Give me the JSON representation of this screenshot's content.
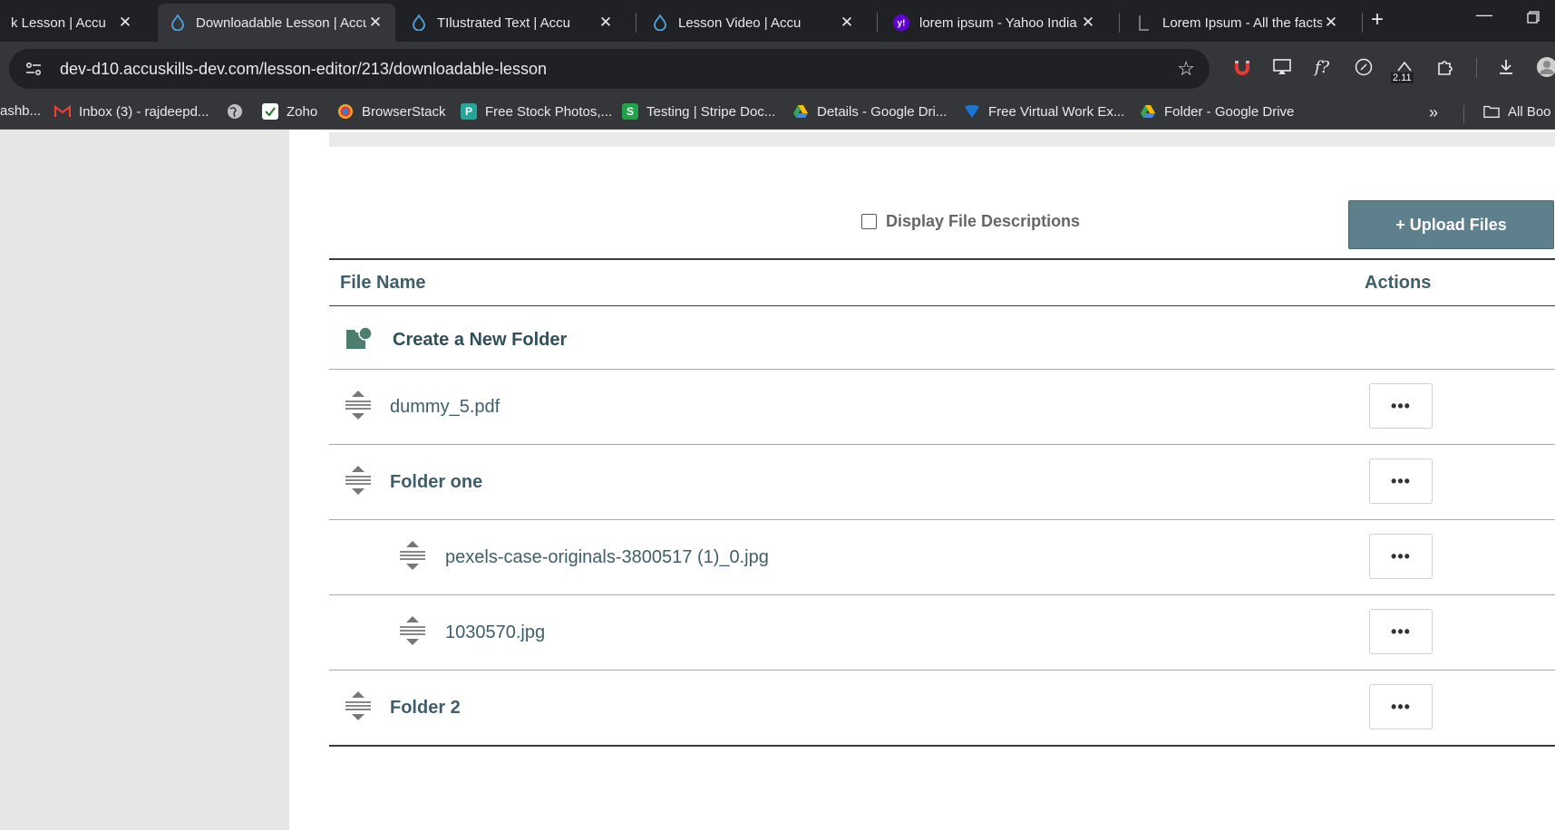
{
  "browser": {
    "tabs": [
      {
        "title": "k Lesson | Accu",
        "active": false
      },
      {
        "title": "Downloadable Lesson | Accu",
        "active": true
      },
      {
        "title": "TIlustrated Text | Accu",
        "active": false
      },
      {
        "title": "Lesson Video | Accu",
        "active": false
      },
      {
        "title": "lorem ipsum - Yahoo India",
        "active": false
      },
      {
        "title": "Lorem Ipsum - All the facts",
        "active": false
      }
    ],
    "url": "dev-d10.accuskills-dev.com/lesson-editor/213/downloadable-lesson",
    "extension_badge": "2.11",
    "bookmarks": [
      {
        "label": "ashb...",
        "icon": "generic-icon"
      },
      {
        "label": "Inbox (3) - rajdeepd...",
        "icon": "gmail-icon"
      },
      {
        "label": "",
        "icon": "globe-icon"
      },
      {
        "label": "Zoho",
        "icon": "zoho-icon"
      },
      {
        "label": "BrowserStack",
        "icon": "browserstack-icon"
      },
      {
        "label": "Free Stock Photos,...",
        "icon": "stock-photos-icon"
      },
      {
        "label": "Testing | Stripe Doc...",
        "icon": "stripe-icon"
      },
      {
        "label": "Details - Google Dri...",
        "icon": "google-drive-icon"
      },
      {
        "label": "Free Virtual Work Ex...",
        "icon": "forage-icon"
      },
      {
        "label": "Folder - Google Drive",
        "icon": "google-drive-icon"
      }
    ],
    "all_bookmarks_label": "All Boo"
  },
  "page": {
    "display_descriptions_label": "Display File Descriptions",
    "upload_button_label": "+ Upload Files",
    "columns": {
      "file_name": "File Name",
      "actions": "Actions"
    },
    "new_folder_label": "Create a New Folder",
    "rows": [
      {
        "name": "dummy_5.pdf",
        "type": "file",
        "indent": 0
      },
      {
        "name": "Folder one",
        "type": "folder",
        "indent": 0
      },
      {
        "name": "pexels-case-originals-3800517 (1)_0.jpg",
        "type": "file",
        "indent": 1
      },
      {
        "name": "1030570.jpg",
        "type": "file",
        "indent": 1
      },
      {
        "name": "Folder 2",
        "type": "folder",
        "indent": 0
      }
    ],
    "actions_label": "•••"
  },
  "colors": {
    "accent": "#5e7f8c",
    "heading_text": "#3f5e6b",
    "folder_icon": "#4d7d6e"
  }
}
